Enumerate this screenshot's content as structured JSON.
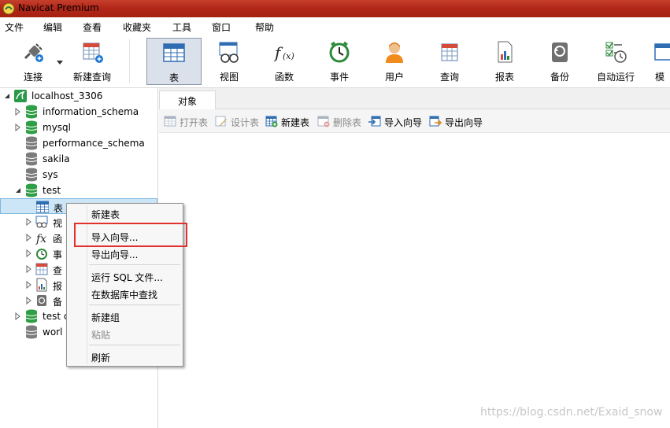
{
  "window": {
    "title": "Navicat Premium"
  },
  "menubar": [
    "文件",
    "编辑",
    "查看",
    "收藏夹",
    "工具",
    "窗口",
    "帮助"
  ],
  "toolbar": {
    "connect": "连接",
    "new_query": "新建查询",
    "buttons": [
      "表",
      "视图",
      "函数",
      "事件",
      "用户",
      "查询",
      "报表",
      "备份",
      "自动运行",
      "模"
    ]
  },
  "tree": {
    "connection": "localhost_3306",
    "databases": [
      "information_schema",
      "mysql",
      "performance_schema",
      "sakila",
      "sys",
      "test"
    ],
    "test_children": [
      "表",
      "视",
      "函",
      "事",
      "查",
      "报",
      "备"
    ],
    "more_databases": [
      "test c",
      "worl"
    ]
  },
  "tabs": {
    "objects": "对象"
  },
  "object_toolbar": [
    "打开表",
    "设计表",
    "新建表",
    "删除表",
    "导入向导",
    "导出向导"
  ],
  "context_menu": [
    "新建表",
    "导入向导...",
    "导出向导...",
    "运行 SQL 文件...",
    "在数据库中查找",
    "新建组",
    "粘贴",
    "刷新"
  ],
  "watermark": "https://blog.csdn.net/Exaid_snow",
  "colors": {
    "titlebar": "#b2281a",
    "highlight": "#e0312f",
    "db_active": "#2f9e45",
    "db_inactive": "#7c7c7c"
  }
}
